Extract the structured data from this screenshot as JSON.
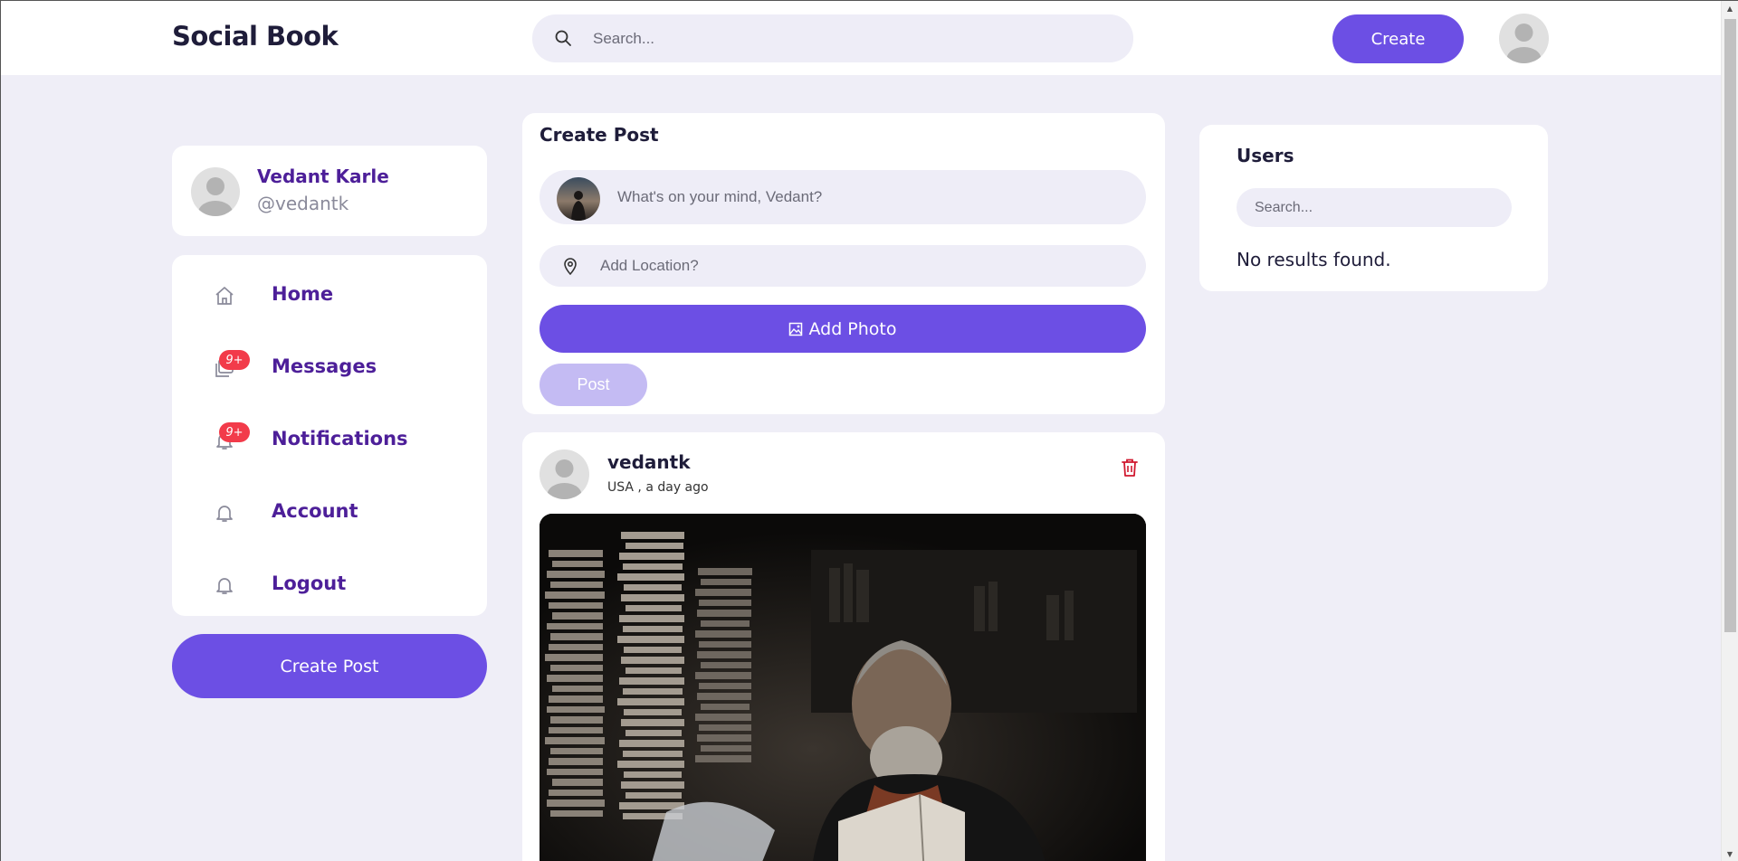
{
  "navbar": {
    "logo": "Social Book",
    "search_placeholder": "Search...",
    "create_label": "Create"
  },
  "profile": {
    "name": "Vedant Karle",
    "handle": "@vedantk"
  },
  "menu": {
    "items": [
      {
        "label": "Home",
        "icon": "home-icon"
      },
      {
        "label": "Messages",
        "icon": "messages-icon",
        "badge": "9+"
      },
      {
        "label": "Notifications",
        "icon": "bell-icon",
        "badge": "9+"
      },
      {
        "label": "Account",
        "icon": "bell-icon"
      },
      {
        "label": "Logout",
        "icon": "bell-icon"
      }
    ],
    "create_post_label": "Create Post"
  },
  "composer": {
    "title": "Create Post",
    "status_placeholder": "What's on your mind, Vedant?",
    "location_placeholder": "Add Location?",
    "add_photo_label": "Add Photo",
    "post_label": "Post"
  },
  "post": {
    "username": "vedantk",
    "meta": "USA , a day ago"
  },
  "users_panel": {
    "title": "Users",
    "search_placeholder": "Search...",
    "empty_text": "No results found."
  },
  "colors": {
    "accent": "#6c4fe4",
    "accent_disabled": "#c4bbf3",
    "menu_text": "#4d1f99",
    "badge": "#f23b4a",
    "page_bg": "#efeef7",
    "delete": "#d0172e"
  }
}
